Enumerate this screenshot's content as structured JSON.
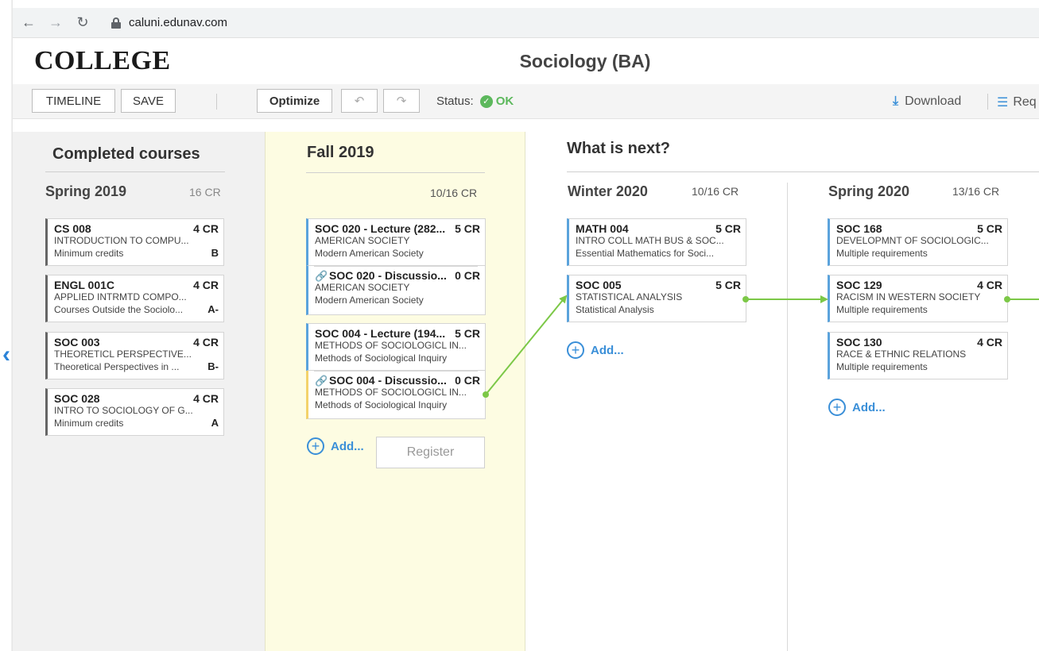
{
  "browser": {
    "url": "caluni.edunav.com",
    "back_icon": "back-arrow-icon",
    "forward_icon": "forward-arrow-icon",
    "reload_icon": "reload-icon"
  },
  "header": {
    "logo": "COLLEGE",
    "program_title": "Sociology (BA)"
  },
  "toolbar": {
    "timeline_label": "TIMELINE",
    "save_label": "SAVE",
    "optimize_label": "Optimize",
    "status_label": "Status:",
    "status_value": "OK",
    "download_label": "Download",
    "requirements_label": "Req"
  },
  "completed": {
    "title": "Completed courses",
    "term": "Spring 2019",
    "term_cr": "16 CR",
    "courses": [
      {
        "code": "CS 008",
        "cr": "4 CR",
        "name": "INTRODUCTION TO COMPU...",
        "req": "Minimum credits",
        "grade": "B"
      },
      {
        "code": "ENGL 001C",
        "cr": "4 CR",
        "name": "APPLIED INTRMTD COMPO...",
        "req": "Courses Outside the Sociolo...",
        "grade": "A-"
      },
      {
        "code": "SOC 003",
        "cr": "4 CR",
        "name": "THEORETICL PERSPECTIVE...",
        "req": "Theoretical Perspectives in ...",
        "grade": "B-"
      },
      {
        "code": "SOC 028",
        "cr": "4 CR",
        "name": "INTRO TO SOCIOLOGY OF G...",
        "req": "Minimum credits",
        "grade": "A"
      }
    ]
  },
  "current": {
    "title": "Fall 2019",
    "term_cr": "10/16 CR",
    "groups": [
      {
        "lecture": {
          "code": "SOC 020 - Lecture (282...",
          "cr": "5 CR",
          "name": "AMERICAN SOCIETY",
          "req": "Modern American Society"
        },
        "discussion": {
          "code": "SOC 020 - Discussio...",
          "cr": "0 CR",
          "name": "AMERICAN SOCIETY",
          "req": "Modern American Society"
        }
      },
      {
        "lecture": {
          "code": "SOC 004 - Lecture (194...",
          "cr": "5 CR",
          "name": "METHODS OF SOCIOLOGICL IN...",
          "req": "Methods of Sociological Inquiry"
        },
        "discussion": {
          "code": "SOC 004 - Discussio...",
          "cr": "0 CR",
          "name": "METHODS OF SOCIOLOGICL IN...",
          "req": "Methods of Sociological Inquiry"
        }
      }
    ],
    "add_label": "Add...",
    "register_label": "Register"
  },
  "next": {
    "title": "What is next?",
    "terms": [
      {
        "title": "Winter 2020",
        "cr": "10/16 CR",
        "courses": [
          {
            "code": "MATH 004",
            "cr": "5 CR",
            "name": "INTRO COLL MATH BUS & SOC...",
            "req": "Essential Mathematics for Soci..."
          },
          {
            "code": "SOC 005",
            "cr": "5 CR",
            "name": "STATISTICAL ANALYSIS",
            "req": "Statistical Analysis"
          }
        ],
        "add_label": "Add..."
      },
      {
        "title": "Spring 2020",
        "cr": "13/16 CR",
        "courses": [
          {
            "code": "SOC 168",
            "cr": "5 CR",
            "name": "DEVELOPMNT OF SOCIOLOGIC...",
            "req": "Multiple requirements"
          },
          {
            "code": "SOC 129",
            "cr": "4 CR",
            "name": "RACISM IN WESTERN SOCIETY",
            "req": "Multiple requirements"
          },
          {
            "code": "SOC 130",
            "cr": "4 CR",
            "name": "RACE & ETHNIC RELATIONS",
            "req": "Multiple requirements"
          }
        ],
        "add_label": "Add..."
      }
    ]
  },
  "colors": {
    "accent_blue": "#3a8fd8",
    "ok_green": "#5cb85c",
    "arrow_green": "#7cc847",
    "current_term_bg": "#fdfce2"
  }
}
